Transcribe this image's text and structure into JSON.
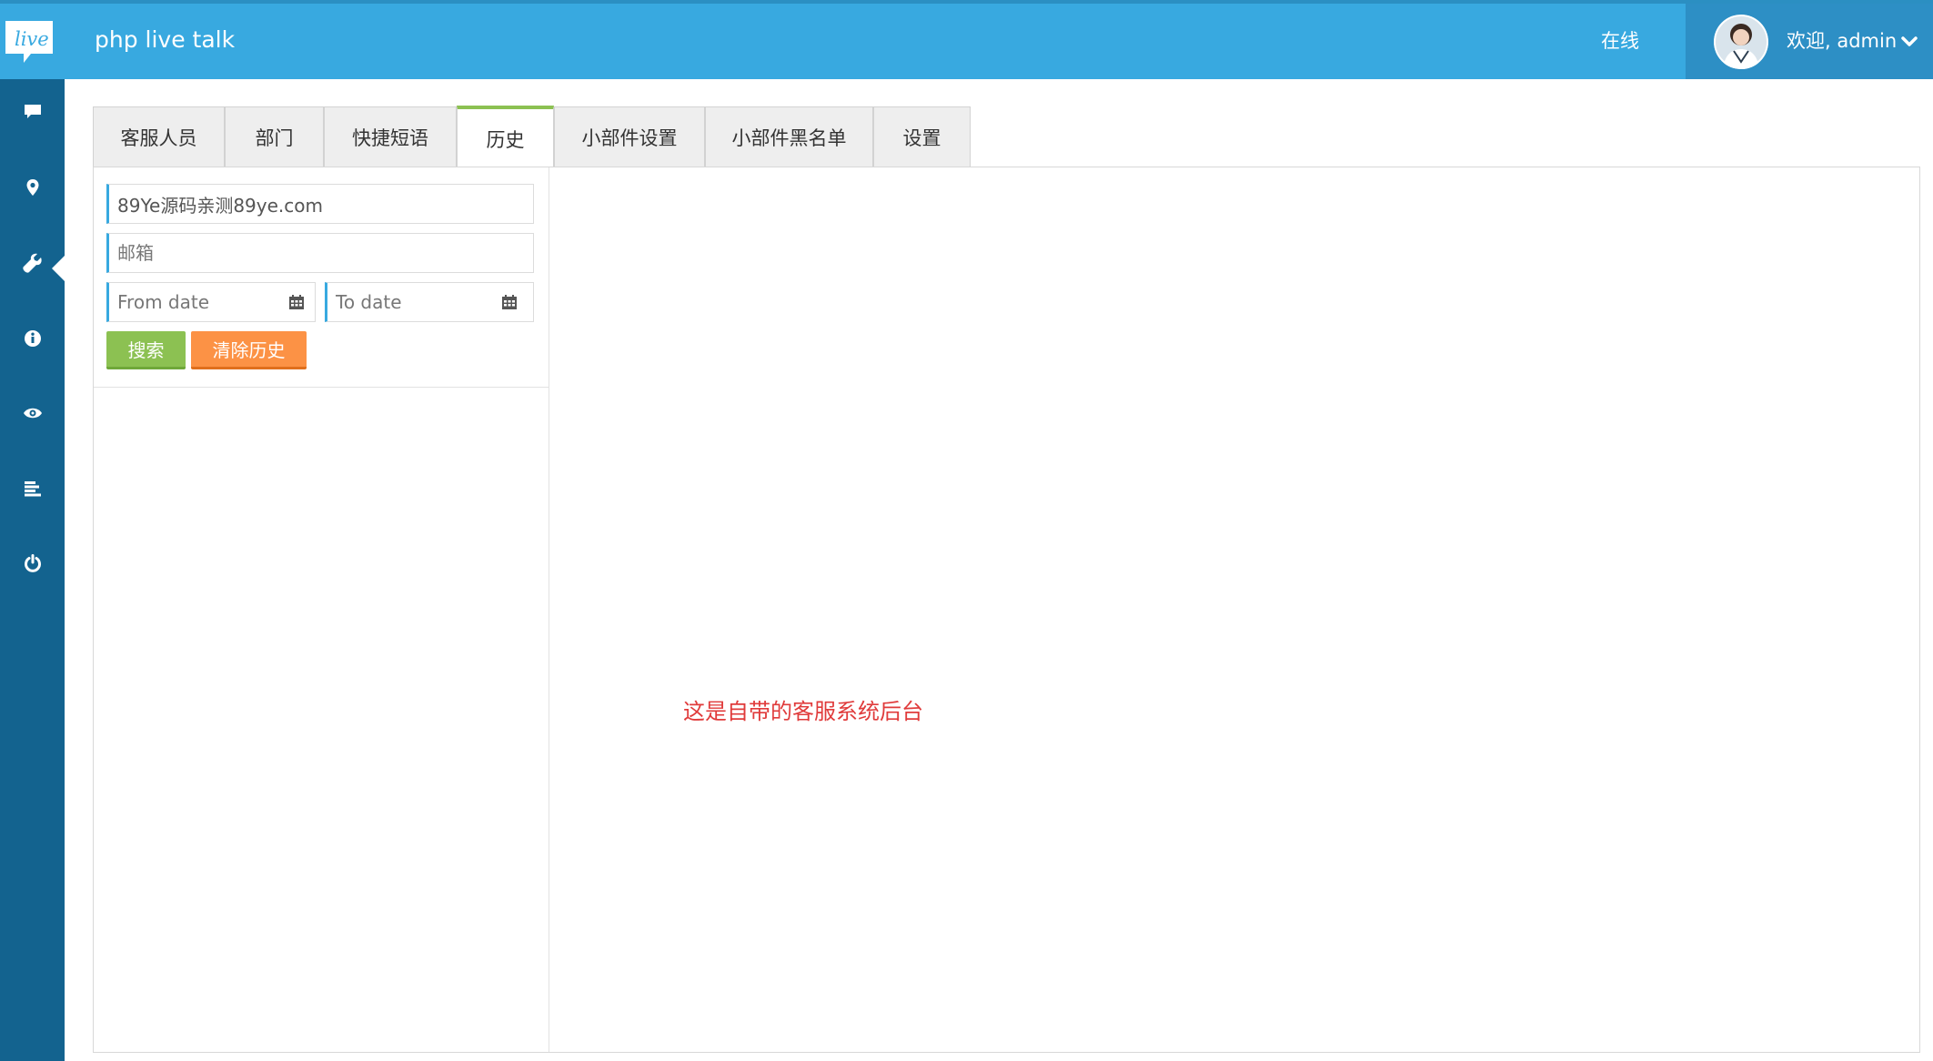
{
  "header": {
    "logo_text": "live",
    "app_title": "php live talk",
    "status": "在线",
    "welcome": "欢迎, admin"
  },
  "sidebar": {
    "items": [
      {
        "icon": "chat-icon"
      },
      {
        "icon": "map-marker-icon"
      },
      {
        "icon": "wrench-icon",
        "active": true
      },
      {
        "icon": "info-icon"
      },
      {
        "icon": "eye-icon"
      },
      {
        "icon": "list-icon"
      },
      {
        "icon": "power-icon"
      }
    ]
  },
  "tabs": [
    {
      "label": "客服人员"
    },
    {
      "label": "部门"
    },
    {
      "label": "快捷短语"
    },
    {
      "label": "历史",
      "active": true
    },
    {
      "label": "小部件设置"
    },
    {
      "label": "小部件黑名单"
    },
    {
      "label": "设置"
    }
  ],
  "history": {
    "name_value": "89Ye源码亲测89ye.com",
    "email_placeholder": "邮箱",
    "from_placeholder": "From date",
    "to_placeholder": "To date",
    "search_label": "搜索",
    "clear_label": "清除历史"
  },
  "note": "这是自带的客服系统后台",
  "colors": {
    "header": "#38a9e0",
    "sidebar": "#13638f",
    "active_tab_accent": "#8cc152",
    "search_button": "#8cc152",
    "clear_button": "#fc9245",
    "note_text": "#e03b3b"
  }
}
